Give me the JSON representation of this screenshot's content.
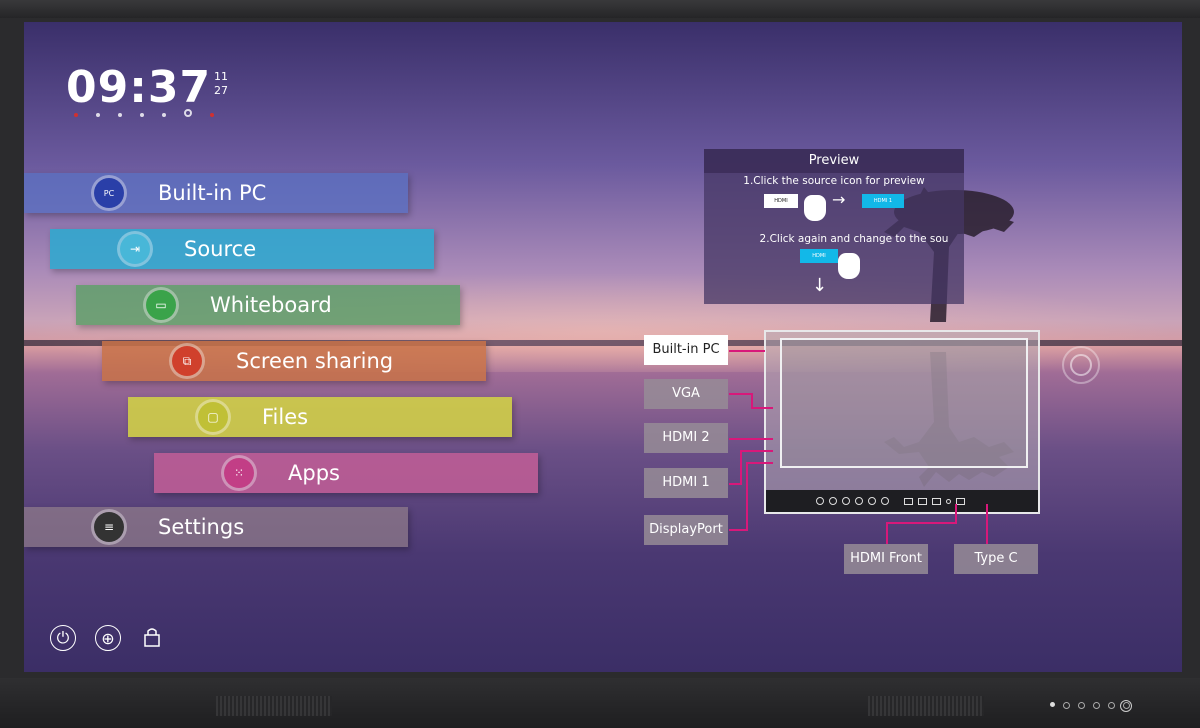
{
  "clock": {
    "time": "09:37",
    "date_top": "11",
    "date_bottom": "27"
  },
  "menu": [
    {
      "label": "Built-in PC",
      "icon": "pc-icon",
      "icon_glyph": "PC",
      "color": "#5c6fbf",
      "icon_color": "#2a3fa8"
    },
    {
      "label": "Source",
      "icon": "source-icon",
      "icon_glyph": "⇥",
      "color": "#2fa8cf",
      "icon_color": "#48b7d8"
    },
    {
      "label": "Whiteboard",
      "icon": "whiteboard-icon",
      "icon_glyph": "▭",
      "color": "#5f9f6a",
      "icon_color": "#3aa34a"
    },
    {
      "label": "Screen sharing",
      "icon": "screen-sharing-icon",
      "icon_glyph": "⧉",
      "color": "#c87248",
      "icon_color": "#d0402c"
    },
    {
      "label": "Files",
      "icon": "folder-icon",
      "icon_glyph": "▢",
      "color": "#c8c84a",
      "icon_color": "#c0c036"
    },
    {
      "label": "Apps",
      "icon": "apps-grid-icon",
      "icon_glyph": "⁙",
      "color": "#c25e96",
      "icon_color": "#c23e86"
    },
    {
      "label": "Settings",
      "icon": "settings-sliders-icon",
      "icon_glyph": "≡",
      "color": "#8a7a86",
      "icon_color": "#333333"
    }
  ],
  "preview": {
    "title": "Preview",
    "step1": "1.Click the source icon for preview",
    "step2": "2.Click again and change to the sou",
    "mini_hdmi_left": "HDMI",
    "mini_hdmi_right": "HDMI 1",
    "mini_hdmi_step2": "HDMI"
  },
  "ports": {
    "builtin_pc": "Built-in PC",
    "vga": "VGA",
    "hdmi2": "HDMI 2",
    "hdmi1": "HDMI 1",
    "displayport": "DisplayPort",
    "hdmi_front": "HDMI Front",
    "type_c": "Type C"
  },
  "bottom_icons": [
    "power-icon",
    "globe-icon",
    "lock-icon"
  ]
}
